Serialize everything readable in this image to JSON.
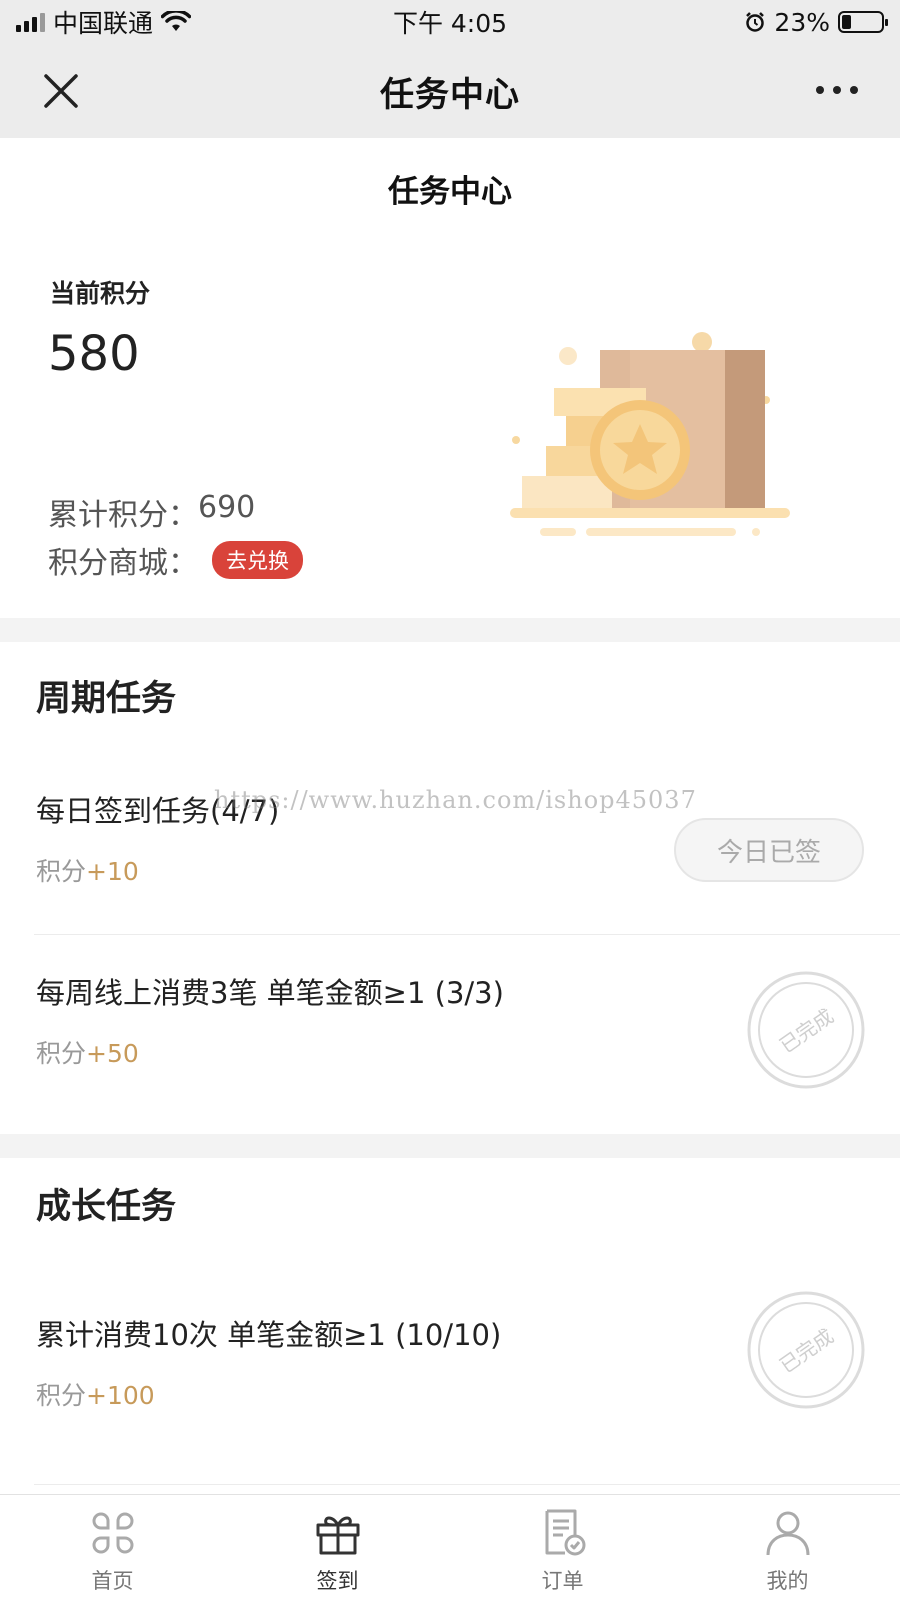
{
  "status_bar": {
    "carrier": "中国联通",
    "time": "下午 4:05",
    "battery": "23%",
    "battery_level": 0.23
  },
  "nav": {
    "title": "任务中心"
  },
  "summary": {
    "page_title": "任务中心",
    "current_points_label": "当前积分",
    "current_points": "580",
    "total_label": "累计积分：",
    "total_points": "690",
    "mall_label": "积分商城：",
    "exchange_label": "去兑换"
  },
  "periodic": {
    "title": "周期任务",
    "tasks": [
      {
        "name": "每日签到任务(4/7)",
        "reward_label": "积分",
        "reward_value": "+10",
        "status": "今日已签"
      },
      {
        "name": "每周线上消费3笔 单笔金额≥1 (3/3)",
        "reward_label": "积分",
        "reward_value": "+50",
        "status": "已完成"
      }
    ]
  },
  "growth": {
    "title": "成长任务",
    "tasks": [
      {
        "name": "累计消费10次 单笔金额≥1 (10/10)",
        "reward_label": "积分",
        "reward_value": "+100",
        "status": "已完成"
      }
    ]
  },
  "watermark": "https://www.huzhan.com/ishop45037",
  "tabs": [
    {
      "label": "首页",
      "icon": "home-grid-icon"
    },
    {
      "label": "签到",
      "icon": "gift-icon",
      "active": true
    },
    {
      "label": "订单",
      "icon": "order-icon"
    },
    {
      "label": "我的",
      "icon": "user-icon"
    }
  ],
  "colors": {
    "accent_red": "#d9433a",
    "reward_gold": "#c79a5a",
    "nav_bg": "#ececec"
  }
}
